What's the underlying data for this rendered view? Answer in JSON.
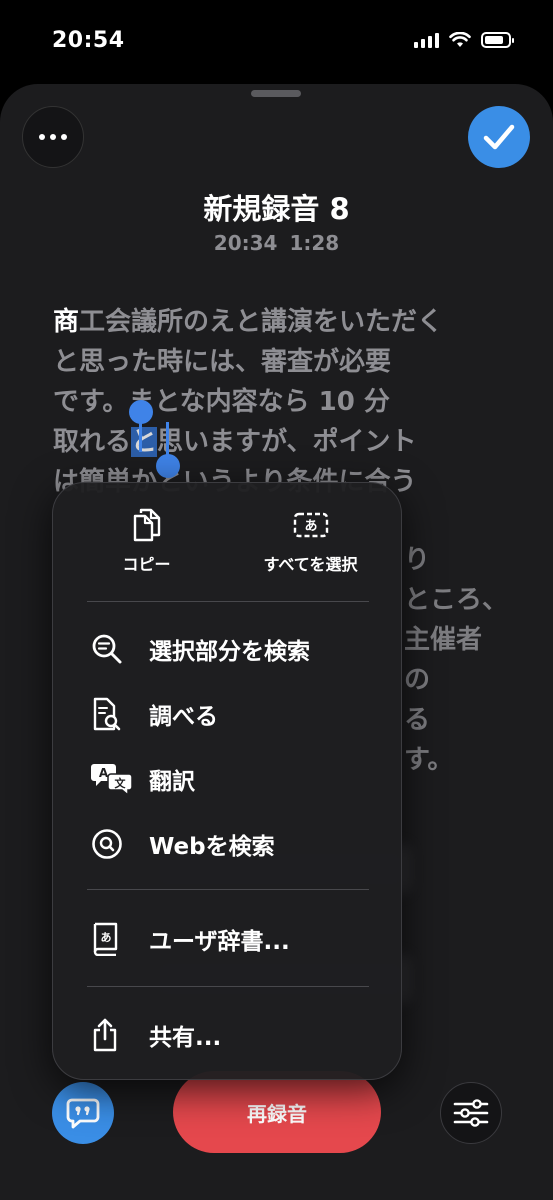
{
  "status_bar": {
    "time": "20:54",
    "battery_level": 0.7
  },
  "header": {
    "title": "新規録音 8",
    "time": "20:34",
    "duration": "1:28"
  },
  "transcript": {
    "first_char": "商",
    "line1_rest": "工会議所のえと講演をいただく",
    "line2": "と思った時には、審査が必要",
    "line3": "です。まとな内容なら 10 分",
    "line4_before": "取れる",
    "line4_selected": "と",
    "line4_after": "思いますが、ポイント",
    "line5": "は簡単かというより条件に合う",
    "right_line1": "り",
    "right_line2": "ところ、",
    "right_line3": "主催者",
    "right_line4": "の",
    "right_line5": "る",
    "right_line6": "す。"
  },
  "context_menu": {
    "copy": "コピー",
    "select_all": "すべてを選択",
    "search_selection": "選択部分を検索",
    "look_up": "調べる",
    "translate": "翻訳",
    "search_web": "Webを検索",
    "user_dictionary": "ユーザ辞書...",
    "share": "共有..."
  },
  "bottom_bar": {
    "record_label": "再録音"
  },
  "colors": {
    "accent": "#3a8ee6",
    "record": "#e5484d",
    "selection": "#2c5ea8"
  }
}
